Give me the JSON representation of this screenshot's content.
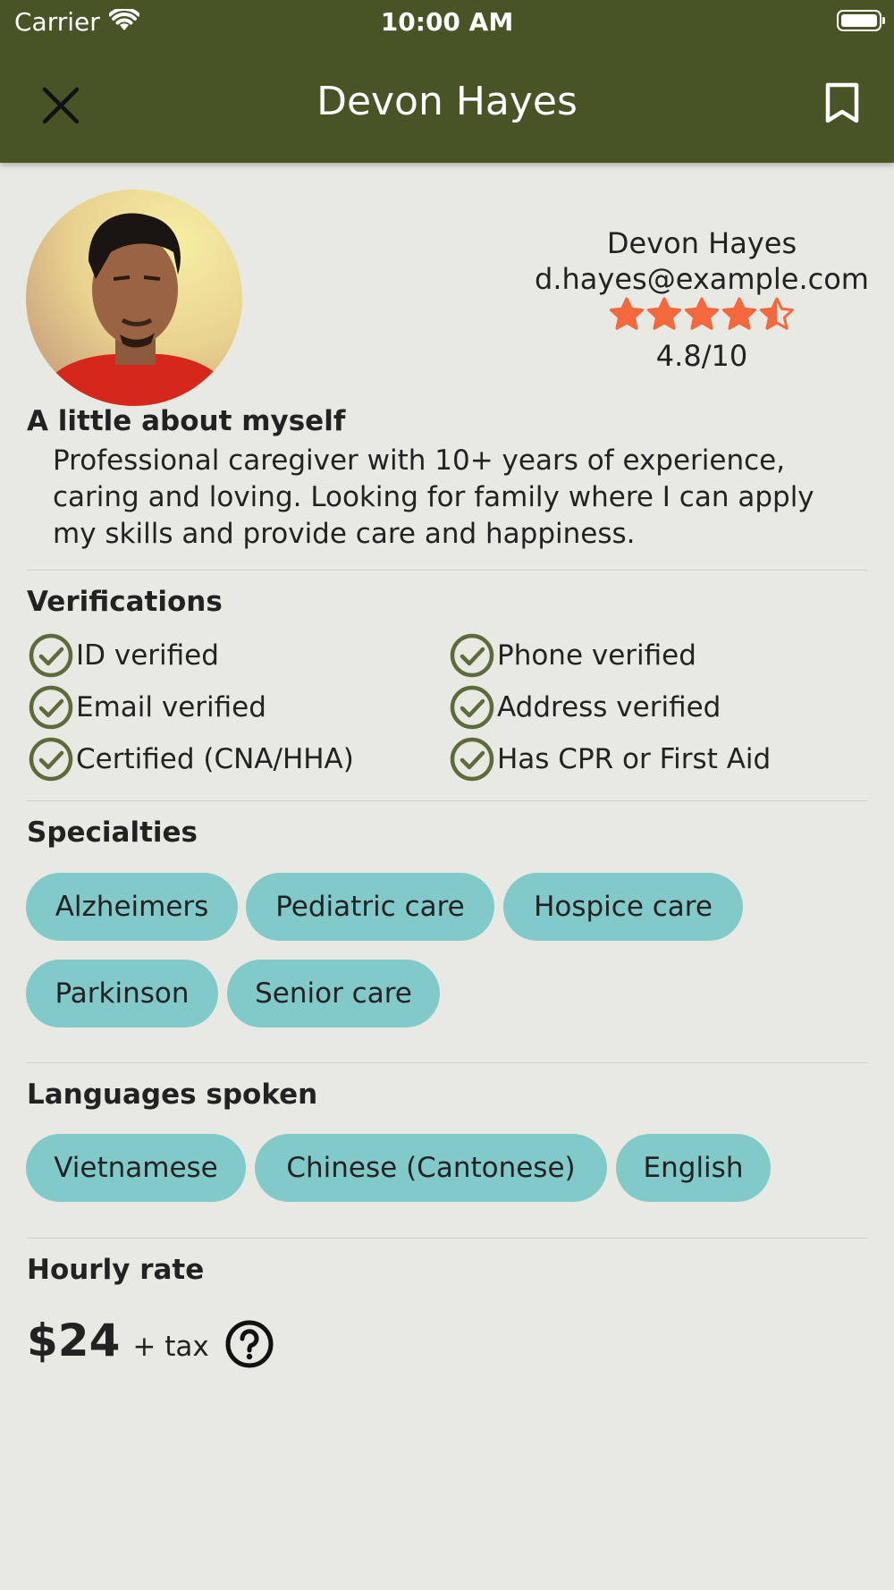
{
  "status_bar": {
    "carrier": "Carrier",
    "time": "10:00 AM"
  },
  "header": {
    "title": "Devon Hayes"
  },
  "profile": {
    "name": "Devon Hayes",
    "email": "d.hayes@example.com",
    "rating": 4.5,
    "rating_text": "4.8/10",
    "star_color": "#f4683e"
  },
  "about": {
    "title": "A little about myself",
    "lines": [
      "Professional caregiver with 10+ years of experience,",
      "caring and loving. Looking for family where I can apply",
      "my skills and provide care and happiness."
    ]
  },
  "verifications": {
    "title": "Verifications",
    "items": [
      "ID verified",
      "Phone verified",
      "Email verified",
      "Address verified",
      "Certified (CNA/HHA)",
      "Has CPR or First Aid"
    ]
  },
  "specialties": {
    "title": "Specialties",
    "items": [
      "Alzheimers",
      "Pediatric care",
      "Hospice care",
      "Parkinson",
      "Senior care"
    ]
  },
  "languages": {
    "title": "Languages spoken",
    "items": [
      "Vietnamese",
      "Chinese (Cantonese)",
      "English"
    ]
  },
  "hourly_rate": {
    "title": "Hourly rate",
    "amount": "$24",
    "tax": "+ tax"
  },
  "colors": {
    "header": "#485326",
    "chip": "#82caca",
    "check": "#5d6a3c",
    "background": "#e9e9e4"
  }
}
